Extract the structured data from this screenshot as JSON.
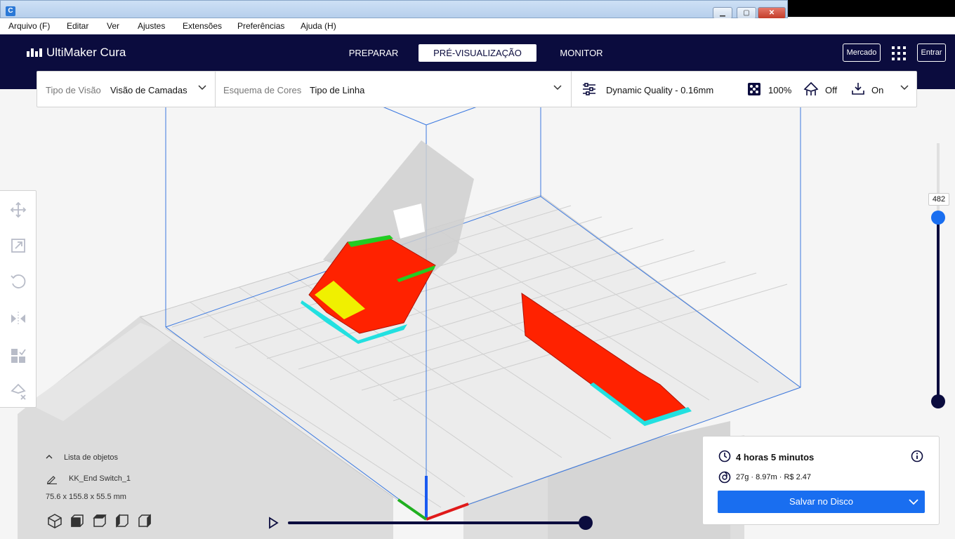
{
  "window": {
    "minimize": "▁",
    "maximize": "▢",
    "close": "✕"
  },
  "menu": [
    {
      "label": "Arquivo (F)"
    },
    {
      "label": "Editar"
    },
    {
      "label": "Ver"
    },
    {
      "label": "Ajustes"
    },
    {
      "label": "Extensões"
    },
    {
      "label": "Preferências"
    },
    {
      "label": "Ajuda (H)"
    }
  ],
  "header": {
    "logo_text": "UltiMaker Cura",
    "tabs": [
      {
        "label": "PREPARAR",
        "active": false
      },
      {
        "label": "PRÉ-VISUALIZAÇÃO",
        "active": true
      },
      {
        "label": "MONITOR",
        "active": false
      }
    ],
    "marketplace_label": "Mercado",
    "signin_label": "Entrar"
  },
  "toolbar": {
    "view_type_label": "Tipo de Visão",
    "view_type_value": "Visão de Camadas",
    "color_scheme_label": "Esquema de Cores",
    "color_scheme_value": "Tipo de Linha",
    "profile": "Dynamic Quality - 0.16mm",
    "infill": "100%",
    "support": "Off",
    "adhesion": "On"
  },
  "objects": {
    "list_label": "Lista de objetos",
    "object_name": "KK_End Switch_1",
    "dimensions": "75.6 x 155.8 x 55.5 mm"
  },
  "layer_slider": {
    "current_layer": "482"
  },
  "print_info": {
    "time": "4 horas 5 minutos",
    "material": "27g · 8.97m · R$ 2.47",
    "save_label": "Salvar no Disco"
  },
  "colors": {
    "header_bg": "#0b0c3e",
    "accent": "#196ef0",
    "wall_red": "#ff2200",
    "infill_yellow": "#f0f000",
    "skin_green": "#22cc22",
    "skirt_cyan": "#22e0e0"
  }
}
